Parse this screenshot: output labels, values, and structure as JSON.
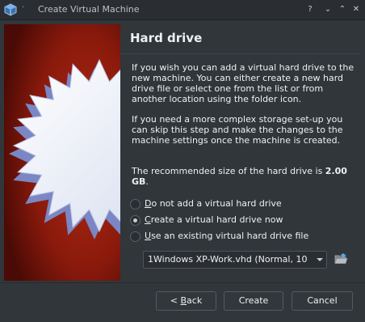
{
  "window": {
    "title": "Create Virtual Machine",
    "menu_glyph": "·",
    "help_glyph": "?",
    "minimize_glyph": "⌄",
    "maximize_glyph": "⌃",
    "close_glyph": "✕"
  },
  "page": {
    "title": "Hard drive",
    "paragraph1": "If you wish you can add a virtual hard drive to the new machine. You can either create a new hard drive file or select one from the list or from another location using the folder icon.",
    "paragraph2": "If you need a more complex storage set-up you can skip this step and make the changes to the machine settings once the machine is created.",
    "recommended_prefix": "The recommended size of the hard drive is ",
    "recommended_size": "2.00 GB",
    "recommended_suffix": "."
  },
  "options": {
    "none": {
      "mnemonic": "D",
      "rest": "o not add a virtual hard drive",
      "checked": false
    },
    "create": {
      "mnemonic": "C",
      "rest": "reate a virtual hard drive now",
      "checked": true
    },
    "existing": {
      "mnemonic": "U",
      "rest": "se an existing virtual hard drive file",
      "checked": false
    }
  },
  "existing_file": {
    "selected": "1Windows XP-Work.vhd (Normal, 10"
  },
  "buttons": {
    "back_prefix": "< ",
    "back_mnemonic": "B",
    "back_rest": "ack",
    "create": "Create",
    "cancel": "Cancel"
  },
  "icons": {
    "app": "virtualbox-icon",
    "folder": "folder-open-icon"
  },
  "colors": {
    "background": "#31363b",
    "titlebar": "#2a2e32",
    "banner_red": "#8a1a0c",
    "banner_star": "#e6ecf7",
    "text": "#eff0f1"
  }
}
